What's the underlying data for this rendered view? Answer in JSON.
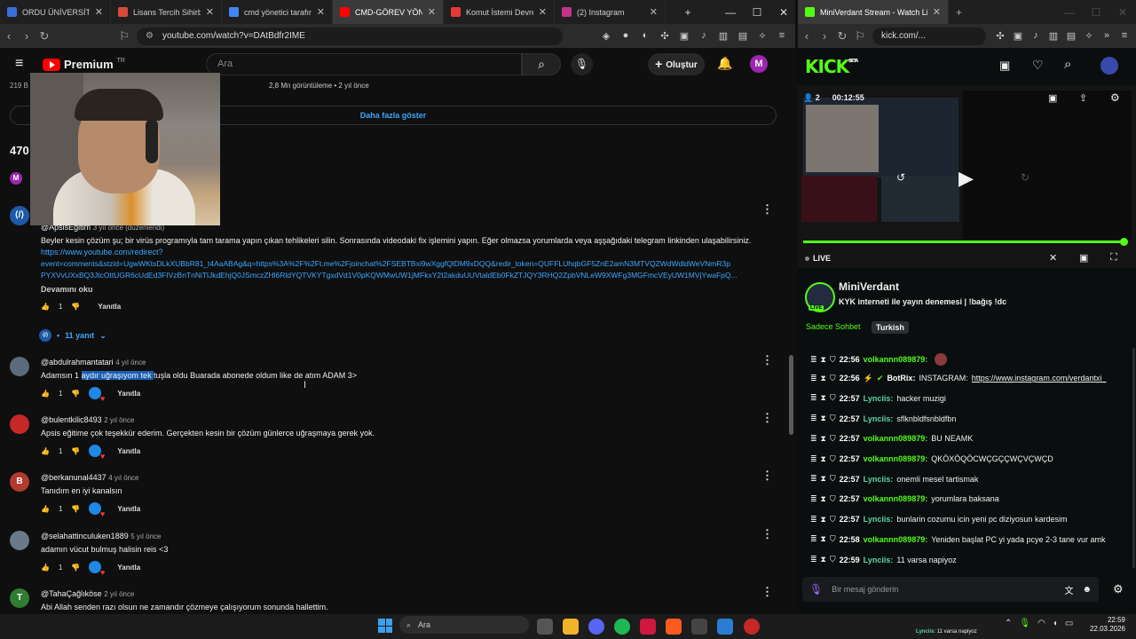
{
  "left_browser": {
    "tabs": [
      {
        "title": "ORDU ÜNİVERSİTESİ - Gen",
        "color": "#3b6fd8"
      },
      {
        "title": "Lisans Tercih Sihirbazı",
        "color": "#d84b3b"
      },
      {
        "title": "cmd yönetici tarafından ça",
        "color": "#4285f4"
      },
      {
        "title": "CMD-GÖREV YÖNETİ",
        "color": "#ff0000"
      },
      {
        "title": "Komut İstemi Devre Dışı B",
        "color": "#e53935"
      },
      {
        "title": "(2) Instagram",
        "color": "#c13584"
      }
    ],
    "url": "youtube.com/watch?v=DAtBdfr2IME"
  },
  "youtube": {
    "brand": "Premium",
    "brand_sup": "TR",
    "search_placeholder": "Ara",
    "create_label": "Oluştur",
    "avatar_letter": "M",
    "views_line": "2,8 Mn görüntüleme • 2 yıl önce",
    "subs_partial": "219 B",
    "show_more": "Daha fazla göster",
    "comment_count_partial": "470",
    "pinned": {
      "author": "@ApsisEğitim",
      "time": "3 yıl önce (düzenlendi)",
      "text": "Beyler kesin çözüm şu; bir virüs programıyla tam tarama yapın çıkan tehlikeleri silin. Sonrasında videodaki fix işlemini yapın. Eğer olmazsa yorumlarda veya aşşağıdaki telegram linkinden ulaşabilirsiniz.",
      "link1": "https://www.youtube.com/redirect?",
      "link2": "event=comments&stzid=UgwWKtsDLkXUBbR81_t4AaABAg&q=https%3A%2F%2Ft.me%2Fjoinchat%2FSEBTBxi9wXggfQlDM9xDQQ&redir_token=QUFFLUhqbGF5ZnE2amN3MTVQZWdWdldWeVNmR3p",
      "link3": "PYXVvUXxBQ3JtcOttUGR6cUdEd3FIVzBnTnNiTlJkdEhjQ0JSmczZHl6RldYQTVKYTgxdVd1V0pKQWMwUW1jMFkxY2I2akduUUVtaldEb0FkZTJQY3RHQ2ZpbVNLeW9XWFg3MGFmcVEyUW1MVjYwaFpQ...",
      "read_more": "Devamını oku",
      "likes": "1",
      "reply": "Yanıtla",
      "replies_label": "11 yanıt"
    },
    "comments": [
      {
        "author": "@abdulrahmantatari",
        "time": "4 yıl önce",
        "text_pre": "Adamsın 1 ",
        "text_hl": "aydır uğraşıyom tek ",
        "text_post": "tuşla oldu Buarada abonede oldum like de atım ADAM 3>",
        "likes": "1",
        "reply": "Yanıtla",
        "avatar_color": "#5b6b7a",
        "avatar_letter": ""
      },
      {
        "author": "@bulentkilic8493",
        "time": "2 yıl önce",
        "text_pre": "Apsis eğitime çok teşekkür ederim. Gerçekten kesin bir çözüm günlerce uğraşmaya gerek yok.",
        "text_hl": "",
        "text_post": "",
        "likes": "1",
        "reply": "Yanıtla",
        "avatar_color": "#c62828",
        "avatar_letter": ""
      },
      {
        "author": "@berkanunal4437",
        "time": "4 yıl önce",
        "text_pre": "Tanıdım en iyi kanalsın",
        "text_hl": "",
        "text_post": "",
        "likes": "1",
        "reply": "Yanıtla",
        "avatar_color": "#b23a2e",
        "avatar_letter": "B"
      },
      {
        "author": "@selahattinculuken1889",
        "time": "5 yıl önce",
        "text_pre": "adamın vücut bulmuş halisin reis <3",
        "text_hl": "",
        "text_post": "",
        "likes": "1",
        "reply": "Yanıtla",
        "avatar_color": "#6a7a8a",
        "avatar_letter": ""
      },
      {
        "author": "@TahaÇağlıköse",
        "time": "2 yıl önce",
        "text_pre": "Abi Allah senden razı olsun ne zamandır çözmeye çalışıyorum sonunda hallettim.",
        "text_hl": "",
        "text_post": "",
        "likes": "",
        "reply": "",
        "avatar_color": "#2e7d32",
        "avatar_letter": "T"
      }
    ]
  },
  "right_browser": {
    "tab_title": "MiniVerdant Stream - Watch Liv",
    "url": "kick.com/...",
    "logo": "KICK",
    "logo_sup": "BETA",
    "viewers": "2",
    "elapsed": "00:12:55",
    "live_label": "LIVE",
    "channel": "MiniVerdant",
    "stream_title": "KYK interneti ile yayın denemesi | !bağış !dc",
    "tag1": "Sadece Sohbet",
    "tag2": "Turkish",
    "chat_placeholder": "Bir mesaj gönderin",
    "chat": [
      {
        "time": "22:56",
        "user": "volkannn089879",
        "msg": "",
        "color": "#53fc18"
      },
      {
        "time": "22:56",
        "user": "BotRix",
        "msg": "INSTAGRAM: ",
        "link": "https://www.instagram.com/verdantxi_",
        "color": "#ffffff"
      },
      {
        "time": "22:57",
        "user": "Lynciis",
        "msg": "hacker muzigi",
        "color": "#5bd4a2"
      },
      {
        "time": "22:57",
        "user": "Lynciis",
        "msg": "sflknbldfsnbldfbn",
        "color": "#5bd4a2"
      },
      {
        "time": "22:57",
        "user": "volkannn089879",
        "msg": "BU NEAMK",
        "color": "#53fc18"
      },
      {
        "time": "22:57",
        "user": "volkannn089879",
        "msg": "QKÖXÖQÖCWÇGÇÇWÇVÇWÇD",
        "color": "#53fc18"
      },
      {
        "time": "22:57",
        "user": "Lynciis",
        "msg": "onemli mesel tartismak",
        "color": "#5bd4a2"
      },
      {
        "time": "22:57",
        "user": "volkannn089879",
        "msg": "yorumlara baksana",
        "color": "#53fc18"
      },
      {
        "time": "22:57",
        "user": "Lynciis",
        "msg": "bunlarin cozumu icin yeni pc diziyosun kardesim",
        "color": "#5bd4a2"
      },
      {
        "time": "22:58",
        "user": "volkannn089879",
        "msg": "Yeniden başlat PC yi yada pcye 2-3 tane vur amk",
        "color": "#53fc18"
      },
      {
        "time": "22:59",
        "user": "Lynciis",
        "msg": "11 varsa napiyoz",
        "color": "#5bd4a2"
      }
    ]
  },
  "taskbar": {
    "search_label": "Ara",
    "clock_time": "22:59",
    "clock_date": "22.03.2026",
    "notif_user": "Lynciis",
    "notif_msg": ": 11 varsa napiyoz"
  }
}
